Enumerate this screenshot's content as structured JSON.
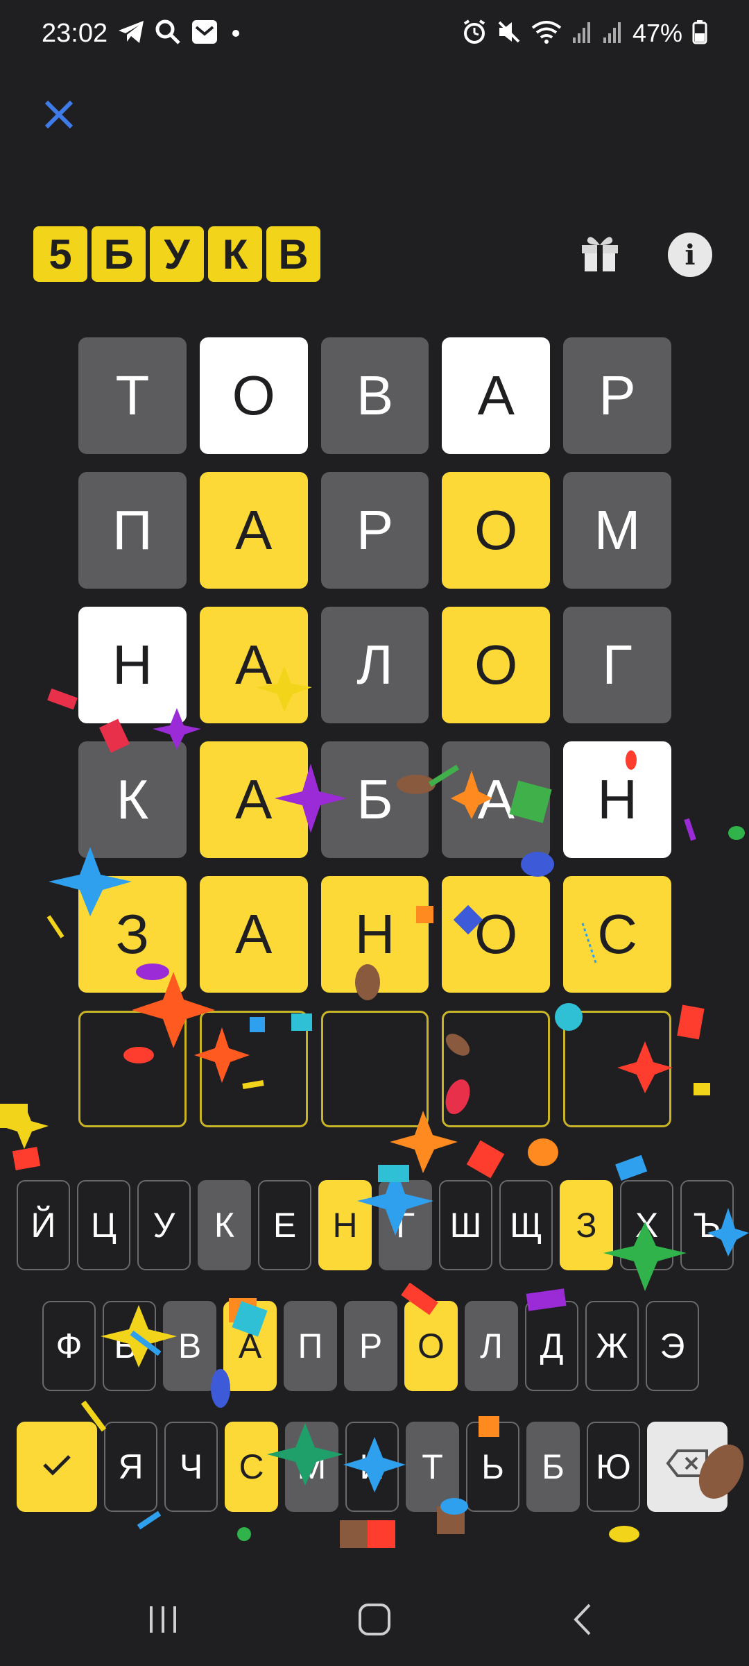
{
  "status_bar": {
    "time": "23:02",
    "battery": "47%",
    "left_icons": [
      "telegram-icon",
      "search-icon",
      "mail-icon",
      "dot-icon"
    ],
    "right_icons": [
      "alarm-icon",
      "mute-icon",
      "wifi-icon",
      "signal-icon",
      "signal-icon",
      "battery-icon"
    ]
  },
  "header": {
    "close_icon": "close-icon",
    "logo_letters": [
      "5",
      "Б",
      "У",
      "К",
      "В"
    ],
    "gift_icon": "gift-icon",
    "info_label": "i"
  },
  "board": {
    "rows": [
      [
        {
          "l": "Т",
          "s": "gray"
        },
        {
          "l": "О",
          "s": "white"
        },
        {
          "l": "В",
          "s": "gray"
        },
        {
          "l": "А",
          "s": "white"
        },
        {
          "l": "Р",
          "s": "gray"
        }
      ],
      [
        {
          "l": "П",
          "s": "gray"
        },
        {
          "l": "А",
          "s": "yellow"
        },
        {
          "l": "Р",
          "s": "gray"
        },
        {
          "l": "О",
          "s": "yellow"
        },
        {
          "l": "М",
          "s": "gray"
        }
      ],
      [
        {
          "l": "Н",
          "s": "white"
        },
        {
          "l": "А",
          "s": "yellow"
        },
        {
          "l": "Л",
          "s": "gray"
        },
        {
          "l": "О",
          "s": "yellow"
        },
        {
          "l": "Г",
          "s": "gray"
        }
      ],
      [
        {
          "l": "К",
          "s": "gray"
        },
        {
          "l": "А",
          "s": "yellow"
        },
        {
          "l": "Б",
          "s": "gray"
        },
        {
          "l": "А",
          "s": "gray"
        },
        {
          "l": "Н",
          "s": "white"
        }
      ],
      [
        {
          "l": "З",
          "s": "yellow"
        },
        {
          "l": "А",
          "s": "yellow"
        },
        {
          "l": "Н",
          "s": "yellow"
        },
        {
          "l": "О",
          "s": "yellow"
        },
        {
          "l": "С",
          "s": "yellow"
        }
      ],
      [
        {
          "l": "",
          "s": "empty"
        },
        {
          "l": "",
          "s": "empty"
        },
        {
          "l": "",
          "s": "empty"
        },
        {
          "l": "",
          "s": "empty"
        },
        {
          "l": "",
          "s": "empty"
        }
      ]
    ]
  },
  "keyboard": {
    "row1": [
      {
        "k": "Й",
        "s": "none"
      },
      {
        "k": "Ц",
        "s": "none"
      },
      {
        "k": "У",
        "s": "none"
      },
      {
        "k": "К",
        "s": "gray"
      },
      {
        "k": "Е",
        "s": "none"
      },
      {
        "k": "Н",
        "s": "yellow"
      },
      {
        "k": "Г",
        "s": "gray"
      },
      {
        "k": "Ш",
        "s": "none"
      },
      {
        "k": "Щ",
        "s": "none"
      },
      {
        "k": "З",
        "s": "yellow"
      },
      {
        "k": "Х",
        "s": "none"
      },
      {
        "k": "Ъ",
        "s": "none"
      }
    ],
    "row2": [
      {
        "k": "Ф",
        "s": "none"
      },
      {
        "k": "Ы",
        "s": "none"
      },
      {
        "k": "В",
        "s": "gray"
      },
      {
        "k": "А",
        "s": "yellow"
      },
      {
        "k": "П",
        "s": "gray"
      },
      {
        "k": "Р",
        "s": "gray"
      },
      {
        "k": "О",
        "s": "yellow"
      },
      {
        "k": "Л",
        "s": "gray"
      },
      {
        "k": "Д",
        "s": "none"
      },
      {
        "k": "Ж",
        "s": "none"
      },
      {
        "k": "Э",
        "s": "none"
      }
    ],
    "row3": [
      {
        "k": "Я",
        "s": "none"
      },
      {
        "k": "Ч",
        "s": "none"
      },
      {
        "k": "С",
        "s": "yellow"
      },
      {
        "k": "М",
        "s": "gray"
      },
      {
        "k": "И",
        "s": "none"
      },
      {
        "k": "Т",
        "s": "gray"
      },
      {
        "k": "Ь",
        "s": "none"
      },
      {
        "k": "Б",
        "s": "gray"
      },
      {
        "k": "Ю",
        "s": "none"
      }
    ],
    "enter_icon": "checkmark-icon",
    "backspace_icon": "backspace-icon"
  },
  "nav_bar": {
    "icons": [
      "recent-apps-icon",
      "home-icon",
      "back-icon"
    ]
  },
  "colors": {
    "background": "#1f1f22",
    "tile_gray": "#5c5c5e",
    "tile_yellow": "#fcd936",
    "tile_white": "#ffffff",
    "accent_blue": "#3f7be8"
  }
}
